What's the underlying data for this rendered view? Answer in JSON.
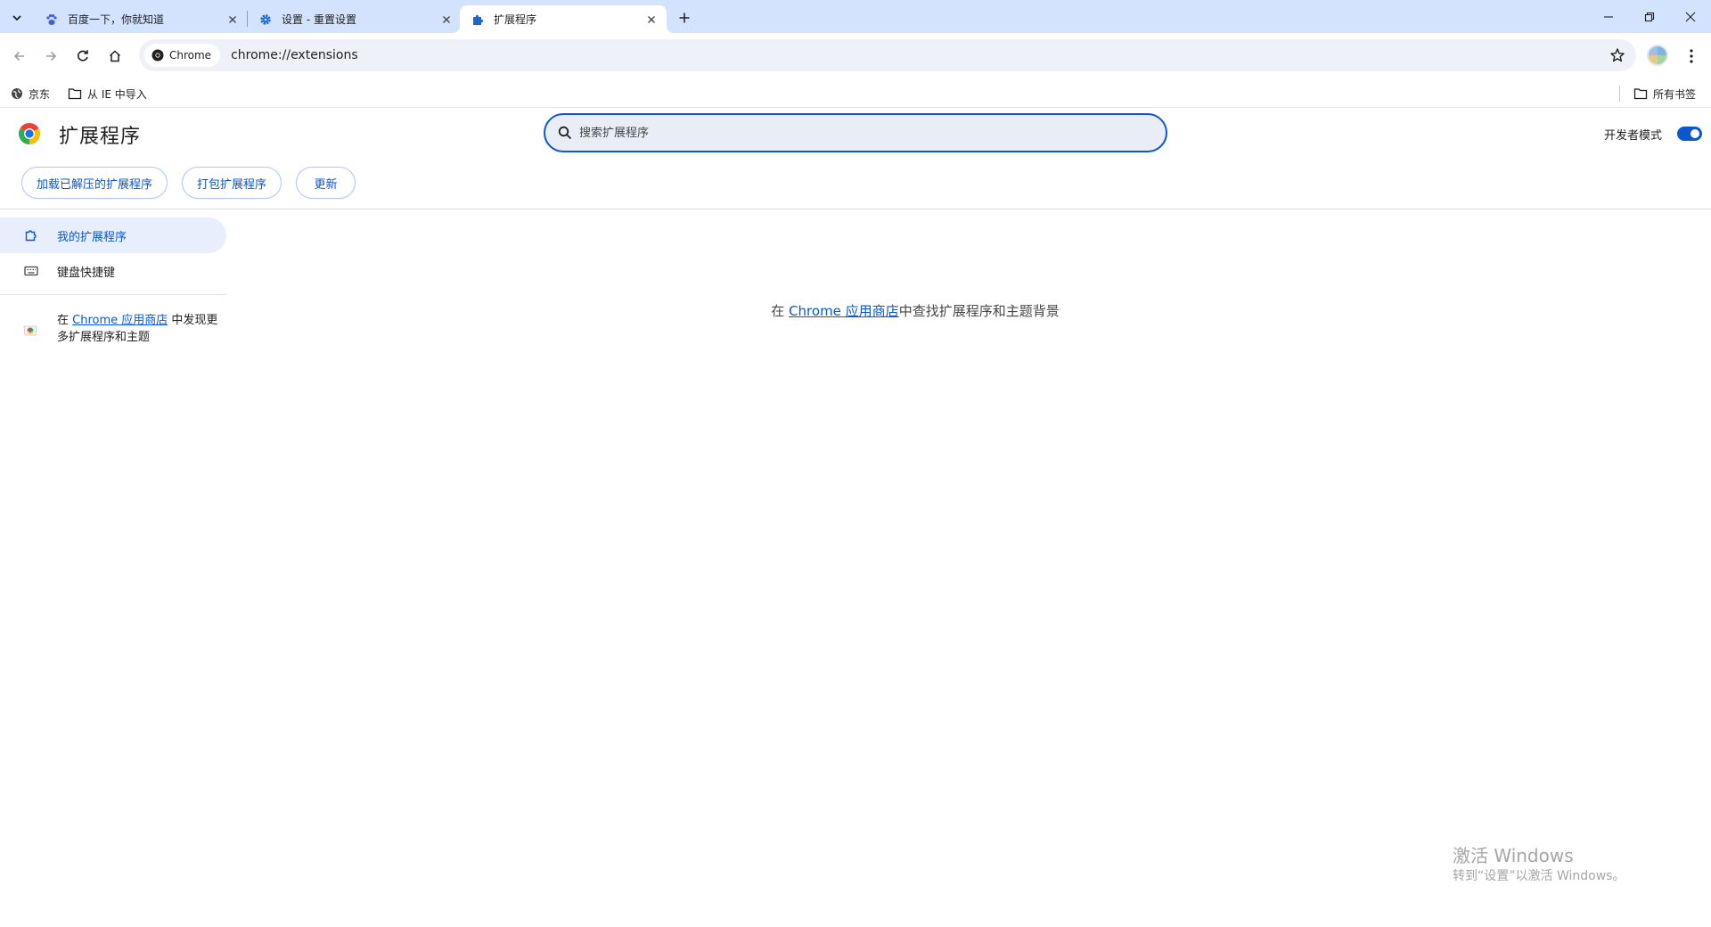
{
  "tabs": [
    {
      "title": "百度一下，你就知道",
      "icon": "baidu-paw-icon",
      "active": false
    },
    {
      "title": "设置 - 重置设置",
      "icon": "gear-icon",
      "active": false
    },
    {
      "title": "扩展程序",
      "icon": "puzzle-icon",
      "active": true
    }
  ],
  "toolbar": {
    "chip_label": "Chrome",
    "url": "chrome://extensions"
  },
  "bookmarks": {
    "items": [
      {
        "label": "京东",
        "icon": "globe-icon"
      },
      {
        "label": "从 IE 中导入",
        "icon": "folder-icon"
      }
    ],
    "all_bookmarks": "所有书签"
  },
  "header": {
    "title": "扩展程序",
    "search_placeholder": "搜索扩展程序",
    "dev_mode_label": "开发者模式",
    "dev_mode_on": true,
    "buttons": {
      "load_unpacked": "加载已解压的扩展程序",
      "pack": "打包扩展程序",
      "update": "更新"
    }
  },
  "sidebar": {
    "items": [
      {
        "label": "我的扩展程序",
        "icon": "extension-icon",
        "selected": true
      },
      {
        "label": "键盘快捷键",
        "icon": "keyboard-icon",
        "selected": false
      }
    ],
    "store": {
      "prefix": "在 ",
      "link": "Chrome 应用商店",
      "suffix": " 中发现更多扩展程序和主题"
    }
  },
  "main": {
    "empty_prefix": "在 ",
    "empty_link": "Chrome 应用商店",
    "empty_suffix": "中查找扩展程序和主题背景"
  },
  "watermark": {
    "title": "激活 Windows",
    "subtitle": "转到“设置”以激活 Windows。"
  },
  "colors": {
    "accent": "#0b57d0",
    "tabstrip": "#d3e3fd",
    "omnibox": "#eef2f8"
  }
}
